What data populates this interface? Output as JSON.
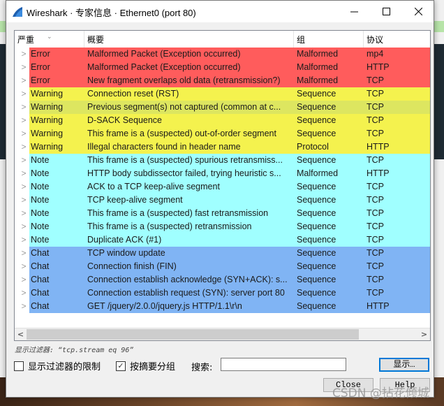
{
  "window": {
    "title": "Wireshark · 专家信息 · Ethernet0 (port 80)",
    "minimize_icon": "minimize-icon",
    "maximize_icon": "maximize-icon",
    "close_icon": "close-icon"
  },
  "colors": {
    "error": "#ff5c5c",
    "warning": "#f4f24e",
    "warning_highlight": "#dde660",
    "note": "#a0ffff",
    "chat": "#80b4f4"
  },
  "table": {
    "columns": [
      "严重",
      "概要",
      "组",
      "协议"
    ],
    "sorted_column": "严重",
    "rows": [
      {
        "severity": "Error",
        "summary": "Malformed Packet (Exception occurred)",
        "group": "Malformed",
        "protocol": "mp4",
        "color": "#ff5c5c"
      },
      {
        "severity": "Error",
        "summary": "Malformed Packet (Exception occurred)",
        "group": "Malformed",
        "protocol": "HTTP",
        "color": "#ff5c5c"
      },
      {
        "severity": "Error",
        "summary": "New fragment overlaps old data (retransmission?)",
        "group": "Malformed",
        "protocol": "TCP",
        "color": "#ff5c5c"
      },
      {
        "severity": "Warning",
        "summary": "Connection reset (RST)",
        "group": "Sequence",
        "protocol": "TCP",
        "color": "#f4f24e"
      },
      {
        "severity": "Warning",
        "summary": "Previous segment(s) not captured (common at c...",
        "group": "Sequence",
        "protocol": "TCP",
        "color": "#dde660"
      },
      {
        "severity": "Warning",
        "summary": "D-SACK Sequence",
        "group": "Sequence",
        "protocol": "TCP",
        "color": "#f4f24e"
      },
      {
        "severity": "Warning",
        "summary": "This frame is a (suspected) out-of-order segment",
        "group": "Sequence",
        "protocol": "TCP",
        "color": "#f4f24e"
      },
      {
        "severity": "Warning",
        "summary": "Illegal characters found in header name",
        "group": "Protocol",
        "protocol": "HTTP",
        "color": "#f4f24e"
      },
      {
        "severity": "Note",
        "summary": "This frame is a (suspected) spurious retransmiss...",
        "group": "Sequence",
        "protocol": "TCP",
        "color": "#a0ffff"
      },
      {
        "severity": "Note",
        "summary": "HTTP body subdissector failed, trying heuristic s...",
        "group": "Malformed",
        "protocol": "HTTP",
        "color": "#a0ffff"
      },
      {
        "severity": "Note",
        "summary": "ACK to a TCP keep-alive segment",
        "group": "Sequence",
        "protocol": "TCP",
        "color": "#a0ffff"
      },
      {
        "severity": "Note",
        "summary": "TCP keep-alive segment",
        "group": "Sequence",
        "protocol": "TCP",
        "color": "#a0ffff"
      },
      {
        "severity": "Note",
        "summary": "This frame is a (suspected) fast retransmission",
        "group": "Sequence",
        "protocol": "TCP",
        "color": "#a0ffff"
      },
      {
        "severity": "Note",
        "summary": "This frame is a (suspected) retransmission",
        "group": "Sequence",
        "protocol": "TCP",
        "color": "#a0ffff"
      },
      {
        "severity": "Note",
        "summary": "Duplicate ACK (#1)",
        "group": "Sequence",
        "protocol": "TCP",
        "color": "#a0ffff"
      },
      {
        "severity": "Chat",
        "summary": "TCP window update",
        "group": "Sequence",
        "protocol": "TCP",
        "color": "#80b4f4"
      },
      {
        "severity": "Chat",
        "summary": "Connection finish (FIN)",
        "group": "Sequence",
        "protocol": "TCP",
        "color": "#80b4f4"
      },
      {
        "severity": "Chat",
        "summary": "Connection establish acknowledge (SYN+ACK): s...",
        "group": "Sequence",
        "protocol": "TCP",
        "color": "#80b4f4"
      },
      {
        "severity": "Chat",
        "summary": "Connection establish request (SYN): server port 80",
        "group": "Sequence",
        "protocol": "TCP",
        "color": "#80b4f4"
      },
      {
        "severity": "Chat",
        "summary": "GET /jquery/2.0.0/jquery.js HTTP/1.1\\r\\n",
        "group": "Sequence",
        "protocol": "HTTP",
        "color": "#80b4f4"
      }
    ]
  },
  "footer": {
    "display_filter": "显示过滤器: “tcp.stream eq 96”",
    "limit_to_filter_label": "显示过滤器的限制",
    "limit_to_filter_checked": false,
    "group_by_summary_label": "按摘要分组",
    "group_by_summary_checked": true,
    "search_label": "搜索:",
    "search_value": "",
    "show_button": "显示…",
    "close_button": "Close",
    "help_button": "Help"
  },
  "watermark": "CSDN @拈花倾城"
}
